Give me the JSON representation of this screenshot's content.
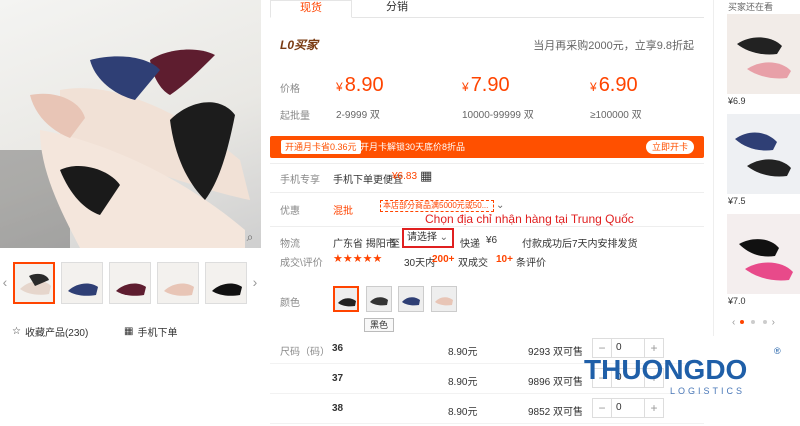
{
  "tabs": {
    "spot": "现货",
    "distribution": "分销"
  },
  "store": {
    "brand": "L0买家",
    "promo": "当月再采购2000元，立享9.8折起"
  },
  "price_section": {
    "price_label": "价格",
    "qty_label": "起批量",
    "tiers": [
      {
        "price": "8.90",
        "range": "2-9999 双"
      },
      {
        "price": "7.90",
        "range": "10000-99999 双"
      },
      {
        "price": "6.90",
        "range": "≥100000 双"
      }
    ],
    "currency": "¥"
  },
  "monthly_card": {
    "tag": "开通月卡省0.36元",
    "text": "开月卡解锁30天底价8折品",
    "button": "立即开卡"
  },
  "mobile": {
    "label": "手机专享",
    "text": "手机下单更便宜",
    "saving": "¥6.83"
  },
  "discount": {
    "label": "优惠",
    "tag": "混批",
    "coupon": "本店部分商品满5000元或50...",
    "chevron": "⌄"
  },
  "shipping": {
    "label": "物流",
    "from": "广东省 揭阳市",
    "to_label": "至",
    "select_value": "请选择",
    "method": "快递",
    "fee": "¥6",
    "note": "付款成功后7天内安排发货"
  },
  "annotation": "Chọn địa chỉ nhận hàng tại Trung Quốc",
  "reviews": {
    "label": "成交\\评价",
    "stars": "★★★★★",
    "deals_prefix": "30天内",
    "deals_count": "200+",
    "deals_suffix": "双成交",
    "reviews_count": "10+",
    "reviews_suffix": "条评价"
  },
  "color": {
    "label": "颜色",
    "tooltip": "黑色"
  },
  "size": {
    "label": "尺码（码）",
    "rows": [
      {
        "size": "36",
        "price": "8.90元",
        "stock": "9293 双可售",
        "qty": "0"
      },
      {
        "size": "37",
        "price": "8.90元",
        "stock": "9896 双可售",
        "qty": "0"
      },
      {
        "size": "38",
        "price": "8.90元",
        "stock": "9852 双可售",
        "qty": "0"
      }
    ]
  },
  "left_actions": {
    "favorite": "收藏产品(230)",
    "mobile_order": "手机下单"
  },
  "recommend": {
    "title": "买家还在看",
    "items": [
      {
        "price": "¥6.9"
      },
      {
        "price": "¥7.5"
      },
      {
        "price": "¥7.0"
      }
    ]
  },
  "watermark": {
    "main": "THUONGDO",
    "sub": "LOGISTICS",
    "reg": "®"
  },
  "colors": {
    "accent": "#ff4400",
    "card": "#ff5000",
    "annotation": "#e02020",
    "brand_blue": "#1f5fa8"
  },
  "icons": [
    "zoom-icon",
    "star-icon",
    "qr-icon",
    "chevron-left-icon",
    "chevron-right-icon",
    "chevron-down-icon"
  ]
}
